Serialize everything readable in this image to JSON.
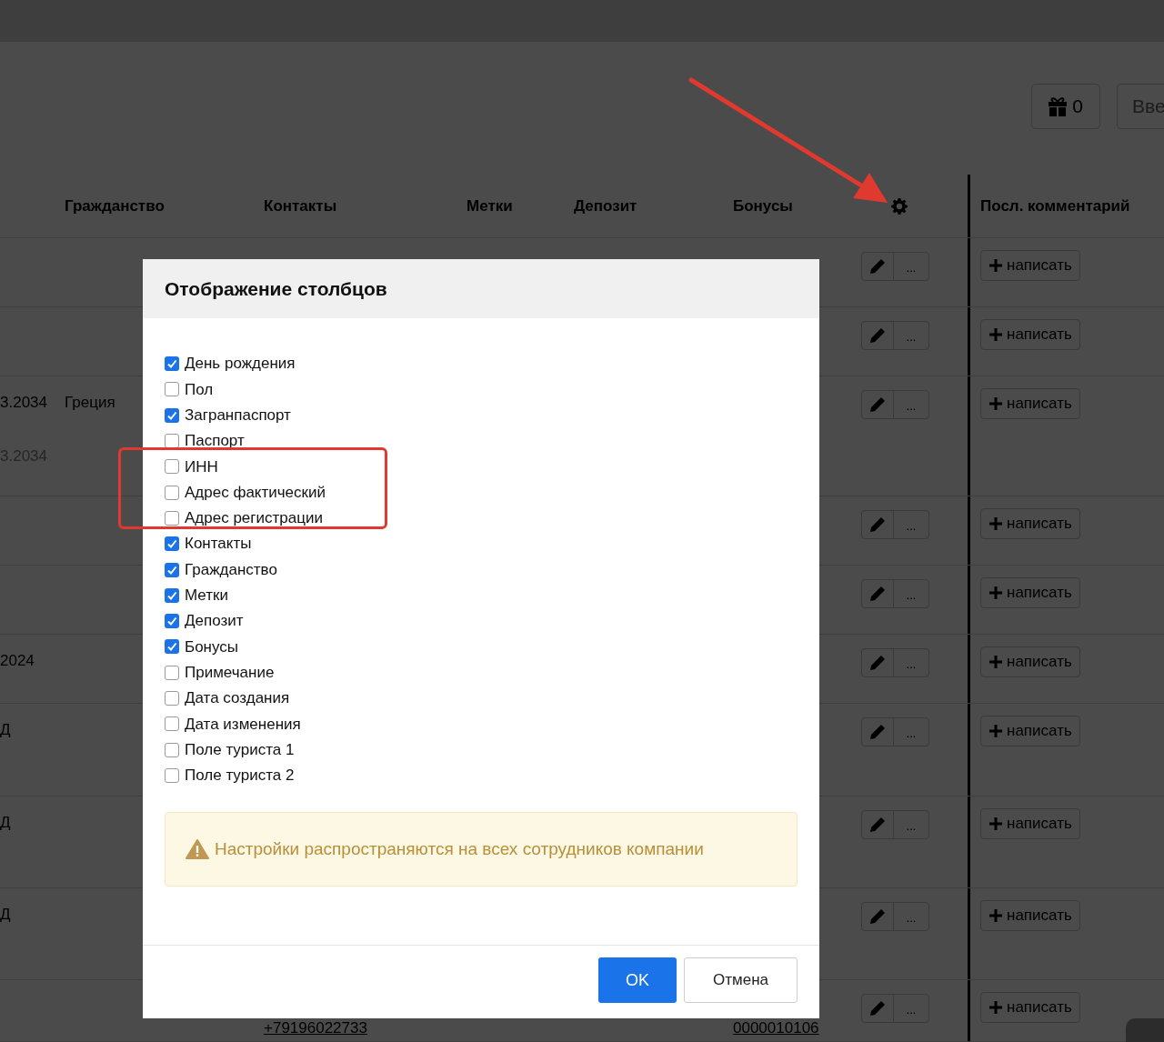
{
  "toolbar": {
    "bonus_button": {
      "count": "0"
    },
    "next_button": {
      "label": "Вве"
    }
  },
  "table": {
    "columns": [
      "Гражданство",
      "Контакты",
      "Метки",
      "Депозит",
      "Бонусы",
      "Посл. комментарий"
    ],
    "rows": [
      {
        "date_lines": [],
        "citizenship": "",
        "contact": "",
        "bonus": "",
        "more": "...",
        "comment": "написать"
      },
      {
        "date_lines": [],
        "citizenship": "",
        "contact": "",
        "bonus": "",
        "more": "...",
        "comment": "написать"
      },
      {
        "date_lines": [
          {
            "text": "3.2034",
            "muted": false
          },
          {
            "text": "3.2034",
            "muted": true
          }
        ],
        "citizenship": "Греция",
        "contact": "",
        "bonus": "",
        "more": "...",
        "comment": "написать"
      },
      {
        "date_lines": [],
        "citizenship": "",
        "contact": "",
        "bonus": "",
        "more": "...",
        "comment": "написать"
      },
      {
        "date_lines": [],
        "citizenship": "",
        "contact": "",
        "bonus": "",
        "more": "...",
        "comment": "написать"
      },
      {
        "date_lines": [
          {
            "text": "2024",
            "muted": false
          }
        ],
        "citizenship": "",
        "contact": "",
        "bonus": "",
        "more": "...",
        "comment": "написать"
      },
      {
        "date_lines": [
          {
            "text": "Д",
            "muted": false
          }
        ],
        "citizenship": "",
        "contact": "",
        "bonus": "",
        "more": "...",
        "comment": "написать"
      },
      {
        "date_lines": [
          {
            "text": "Д",
            "muted": false
          }
        ],
        "citizenship": "",
        "contact": "",
        "bonus": "",
        "more": "...",
        "comment": "написать"
      },
      {
        "date_lines": [
          {
            "text": "Д",
            "muted": false
          }
        ],
        "citizenship": "",
        "contact": "",
        "bonus": "",
        "more": "...",
        "comment": "написать"
      },
      {
        "date_lines": [],
        "citizenship": "",
        "contact": "+79196022733",
        "bonus": "0000010106",
        "more": "...",
        "comment": "написать"
      }
    ]
  },
  "dialog": {
    "title": "Отображение столбцов",
    "options": [
      {
        "label": "День рождения",
        "checked": true
      },
      {
        "label": "Пол",
        "checked": false
      },
      {
        "label": "Загранпаспорт",
        "checked": true
      },
      {
        "label": "Паспорт",
        "checked": false
      },
      {
        "label": "ИНН",
        "checked": false
      },
      {
        "label": "Адрес фактический",
        "checked": false
      },
      {
        "label": "Адрес регистрации",
        "checked": false
      },
      {
        "label": "Контакты",
        "checked": true
      },
      {
        "label": "Гражданство",
        "checked": true
      },
      {
        "label": "Метки",
        "checked": true
      },
      {
        "label": "Депозит",
        "checked": true
      },
      {
        "label": "Бонусы",
        "checked": true
      },
      {
        "label": "Примечание",
        "checked": false
      },
      {
        "label": "Дата создания",
        "checked": false
      },
      {
        "label": "Дата изменения",
        "checked": false
      },
      {
        "label": "Поле туриста 1",
        "checked": false
      },
      {
        "label": "Поле туриста 2",
        "checked": false
      }
    ],
    "warning": "Настройки распространяются на всех сотрудников компании",
    "ok_button": "OK",
    "cancel_button": "Отмена"
  }
}
